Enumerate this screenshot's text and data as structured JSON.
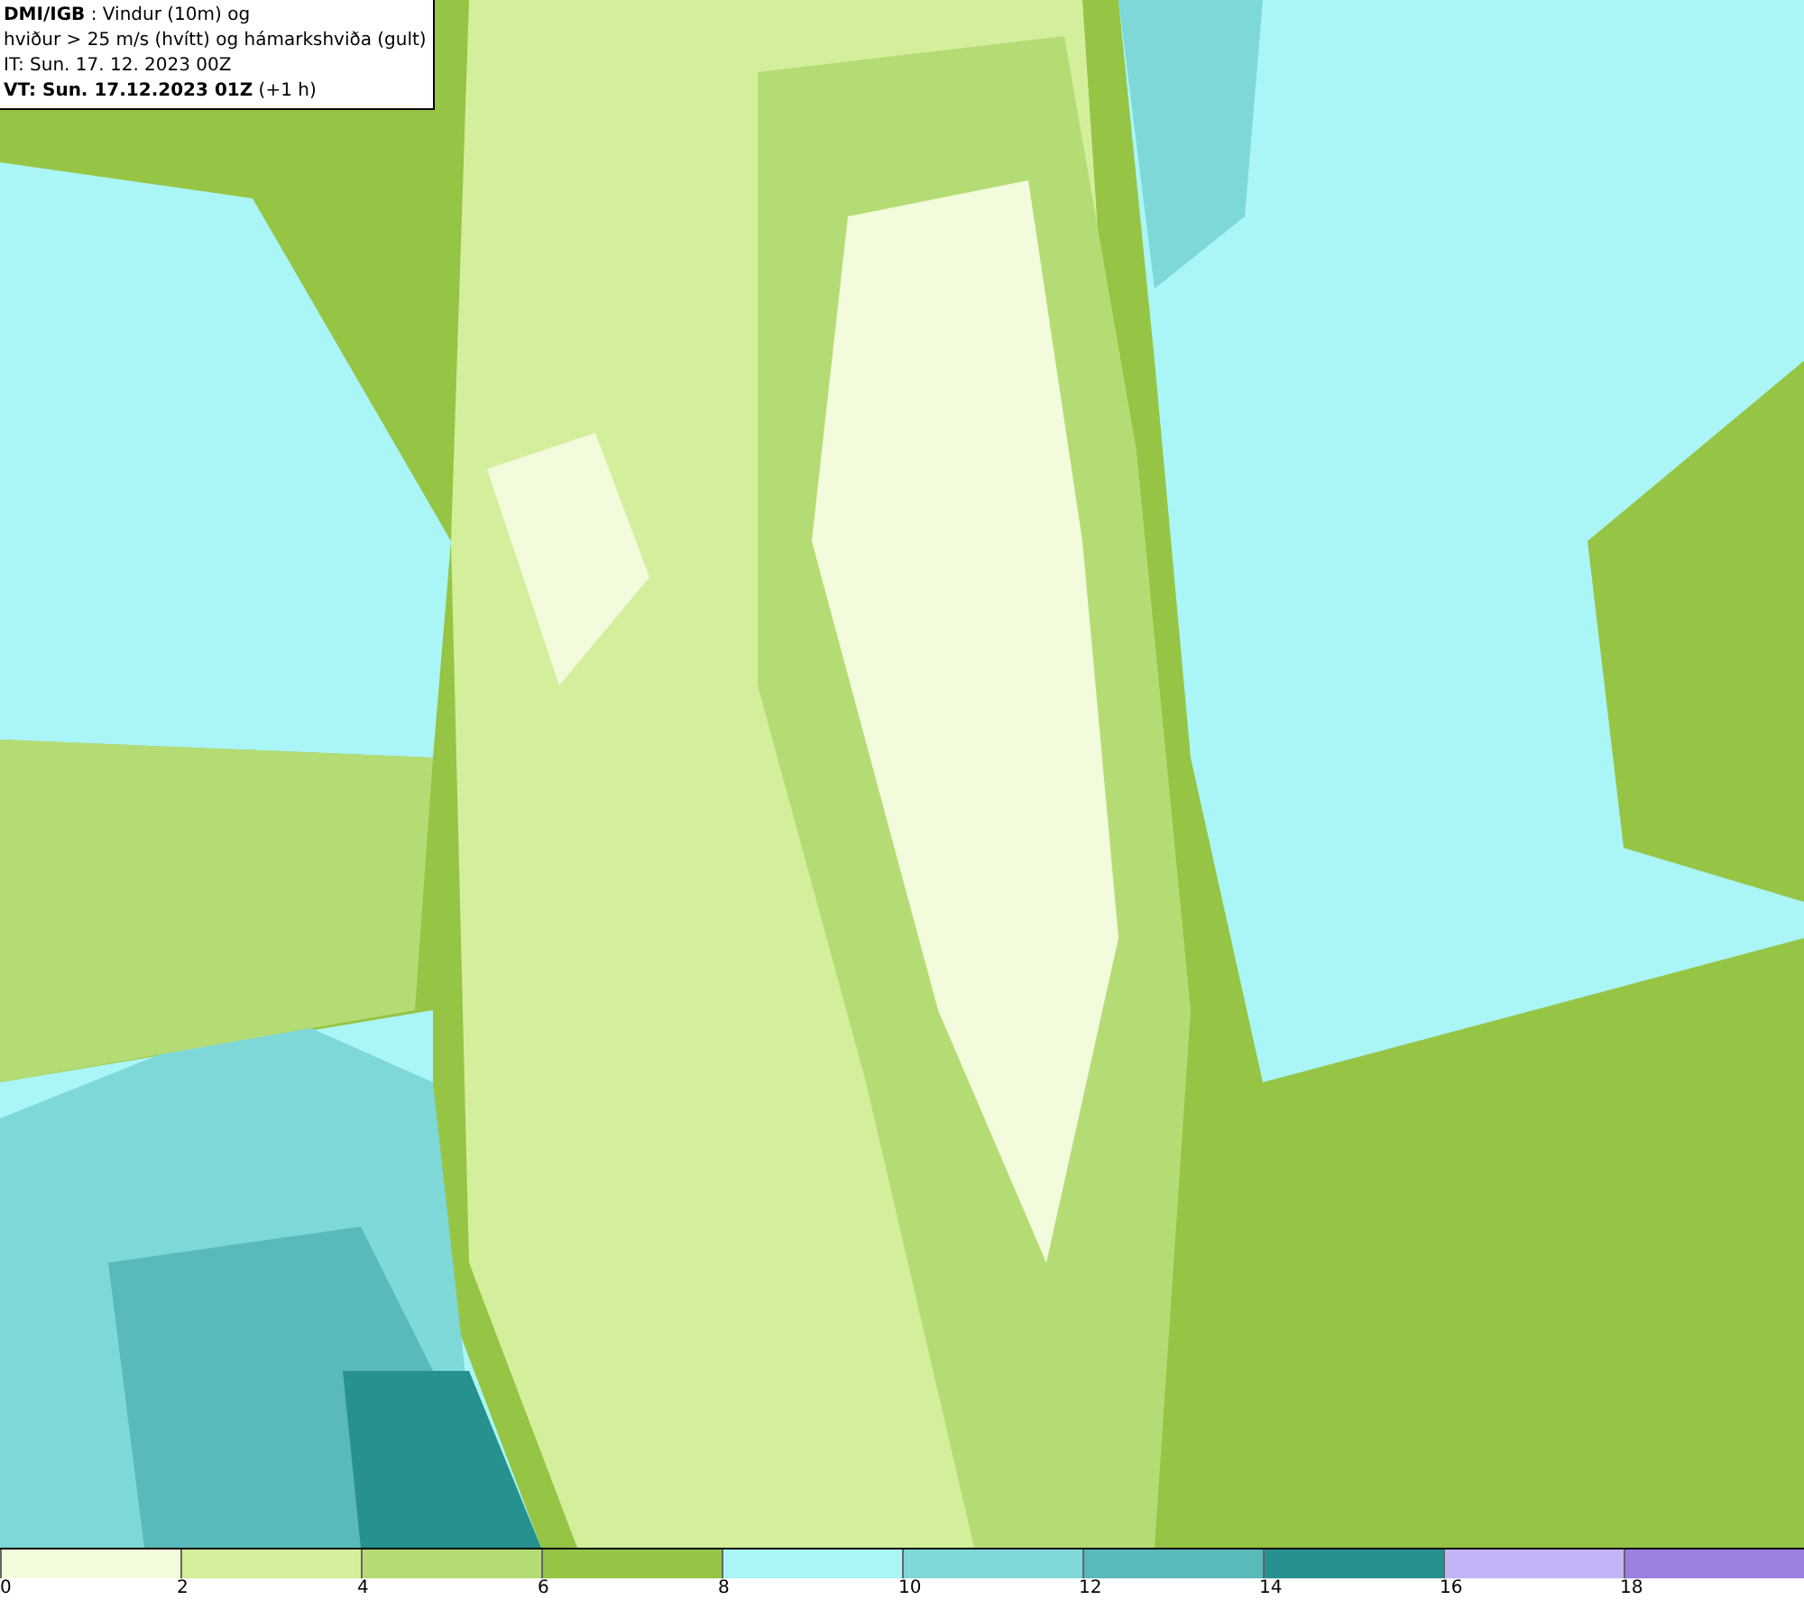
{
  "header": {
    "lines": [
      "**DMI/IGB** : Vindur (10m) og",
      "hviður > 25 m/s (hvítt) og hámarkshviða (gult)",
      "IT: Sun. 17. 12. 2023 00Z",
      "**VT: Sun. 17.12.2023 01Z** (+1 h)"
    ]
  },
  "legend": [
    {
      "color": "#f2fcdc",
      "label": "0"
    },
    {
      "color": "#d4ef9c",
      "label": "2"
    },
    {
      "color": "#b5dc74",
      "label": "4"
    },
    {
      "color": "#96c445",
      "label": "6"
    },
    {
      "color": "#aaf6f6",
      "label": "8"
    },
    {
      "color": "#7fd8d8",
      "label": "10"
    },
    {
      "color": "#5ab9b9",
      "label": "12"
    },
    {
      "color": "#26918f",
      "label": "14"
    },
    {
      "color": "#c3b4f8",
      "label": "16"
    },
    {
      "color": "#9b80e0",
      "label": "18"
    }
  ]
}
